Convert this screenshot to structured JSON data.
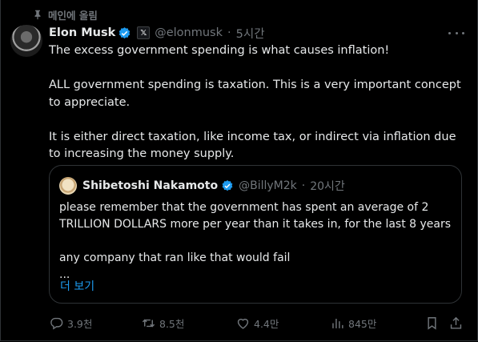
{
  "pinned_label": "메인에 올림",
  "tweet": {
    "author_name": "Elon Musk",
    "handle": "@elonmusk",
    "time": "5시간",
    "paragraphs": [
      "The excess government spending is what causes inflation!",
      "ALL government spending is taxation. This is a very important concept to appreciate.",
      "It is either direct taxation, like income tax, or indirect via inflation due to increasing the money supply."
    ]
  },
  "quote": {
    "author_name": "Shibetoshi Nakamoto",
    "handle": "@BillyM2k",
    "time": "20시간",
    "paragraphs": [
      "please remember that the government has spent an average of 2 TRILLION DOLLARS more per year than it takes in, for the last 8 years",
      "any company that ran like that would fail",
      "..."
    ],
    "show_more": "더 보기"
  },
  "actions": {
    "replies": "3.9천",
    "reposts": "8.5천",
    "likes": "4.4만",
    "views": "845만"
  },
  "colors": {
    "background": "#000000",
    "text": "#e7e9ea",
    "muted": "#71767b",
    "accent": "#1d9bf0",
    "border": "#2f3336"
  }
}
